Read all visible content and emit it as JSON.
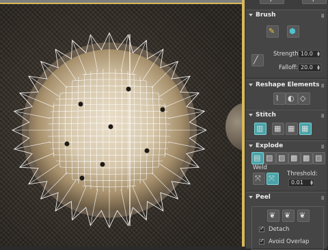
{
  "panel": {
    "top_toolbar_icon": "move-plus-icon",
    "brush": {
      "title": "Brush",
      "tools": [
        "paint-brush-icon",
        "relax-cube-icon",
        "line-brush-icon"
      ],
      "strength_label": "Strength:",
      "strength_value": "10.0",
      "falloff_label": "Falloff:",
      "falloff_value": "20.0"
    },
    "reshape": {
      "title": "Reshape Elements",
      "tools": [
        "straighten-icon",
        "relax-sphere-icon",
        "cube-icon"
      ]
    },
    "stitch": {
      "title": "Stitch",
      "tools": [
        "stitch-source-icon",
        "stitch-average-icon",
        "stitch-target-icon",
        "stitch-custom-icon"
      ]
    },
    "explode": {
      "title": "Explode",
      "tools": [
        "explode-a-icon",
        "explode-b-icon",
        "explode-c-icon",
        "explode-d-icon",
        "explode-e-icon",
        "explode-f-icon"
      ],
      "weld_label": "Weld",
      "threshold_label": "Threshold:",
      "threshold_value": "0.01"
    },
    "peel": {
      "title": "Peel",
      "tools": [
        "peel-a-icon",
        "peel-b-icon",
        "peel-c-icon"
      ],
      "detach_label": "Detach",
      "detach_checked": true,
      "avoid_overlap_label": "Avoid Overlap",
      "avoid_overlap_checked": true
    }
  },
  "colors": {
    "accent": "#4aa3a8",
    "frame": "#d9b85a",
    "panel_bg": "#454545",
    "wire": "#ffffff"
  }
}
